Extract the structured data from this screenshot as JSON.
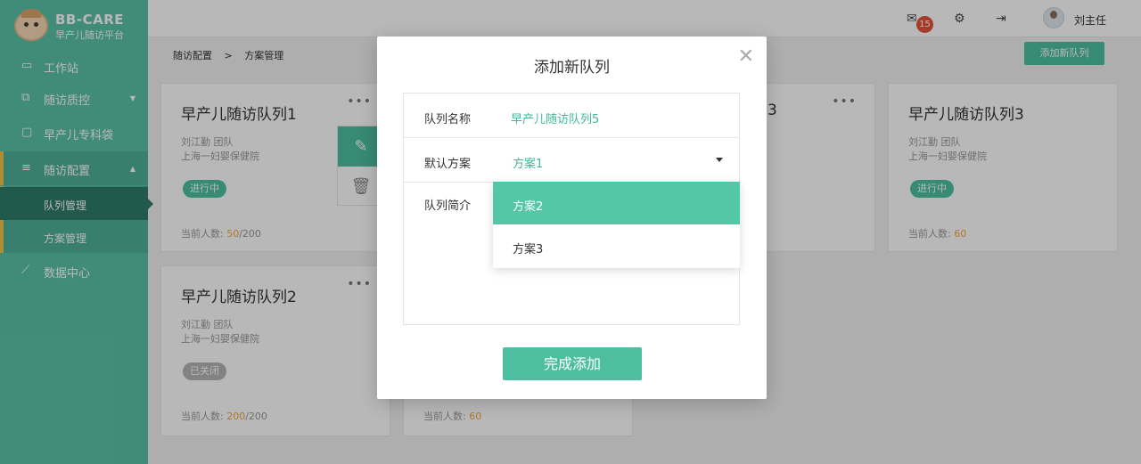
{
  "brand": {
    "title": "BB-CARE",
    "subtitle": "早产儿随访平台"
  },
  "sidebar": {
    "items": [
      {
        "label": "工作站",
        "icon": "monitor-icon"
      },
      {
        "label": "随访质控",
        "icon": "chart-icon"
      },
      {
        "label": "早产儿专科袋",
        "icon": "folder-icon"
      },
      {
        "label": "随访配置",
        "icon": "sliders-icon"
      },
      {
        "label": "数据中心",
        "icon": "line-chart-icon"
      }
    ],
    "sub_items": [
      {
        "label": "队列管理"
      },
      {
        "label": "方案管理"
      }
    ]
  },
  "header": {
    "mail_count": "15",
    "username": "刘主任"
  },
  "breadcrumb": {
    "parent": "随访配置",
    "separator": ">",
    "current": "方案管理"
  },
  "toolbar": {
    "add_label": "添加新队列"
  },
  "cards": [
    {
      "title": "早产儿随访队列1",
      "owner": "刘江勤 团队",
      "hospital": "上海一妇婴保健院",
      "status": "进行中",
      "count_label": "当前人数: ",
      "count": "50",
      "total": "/200"
    },
    {
      "title": "早产儿随访队列3",
      "owner": "刘江勤 团队",
      "hospital": "上海一妇婴保健院",
      "status": "进行中",
      "count_label": "当前人数: ",
      "count": "60",
      "total": ""
    },
    {
      "title": "早产儿随访队列2",
      "owner": "刘江勤 团队",
      "hospital": "上海一妇婴保健院",
      "status": "已关闭",
      "count_label": "当前人数: ",
      "count": "200",
      "total": "/200"
    },
    {
      "title": "",
      "count_label": "当前人数: ",
      "count": "60",
      "total": ""
    },
    {
      "title": "3"
    }
  ],
  "modal": {
    "title": "添加新队列",
    "name_label": "队列名称",
    "name_value": "早产儿随访队列5",
    "plan_label": "默认方案",
    "plan_value": "方案1",
    "desc_label": "队列简介",
    "options": [
      "方案2",
      "方案3"
    ],
    "submit_label": "完成添加"
  },
  "colors": {
    "accent": "#4dbfa0",
    "sidebar": "#5bc3a8",
    "highlight": "#f0a73b",
    "badge": "#e5533a"
  }
}
